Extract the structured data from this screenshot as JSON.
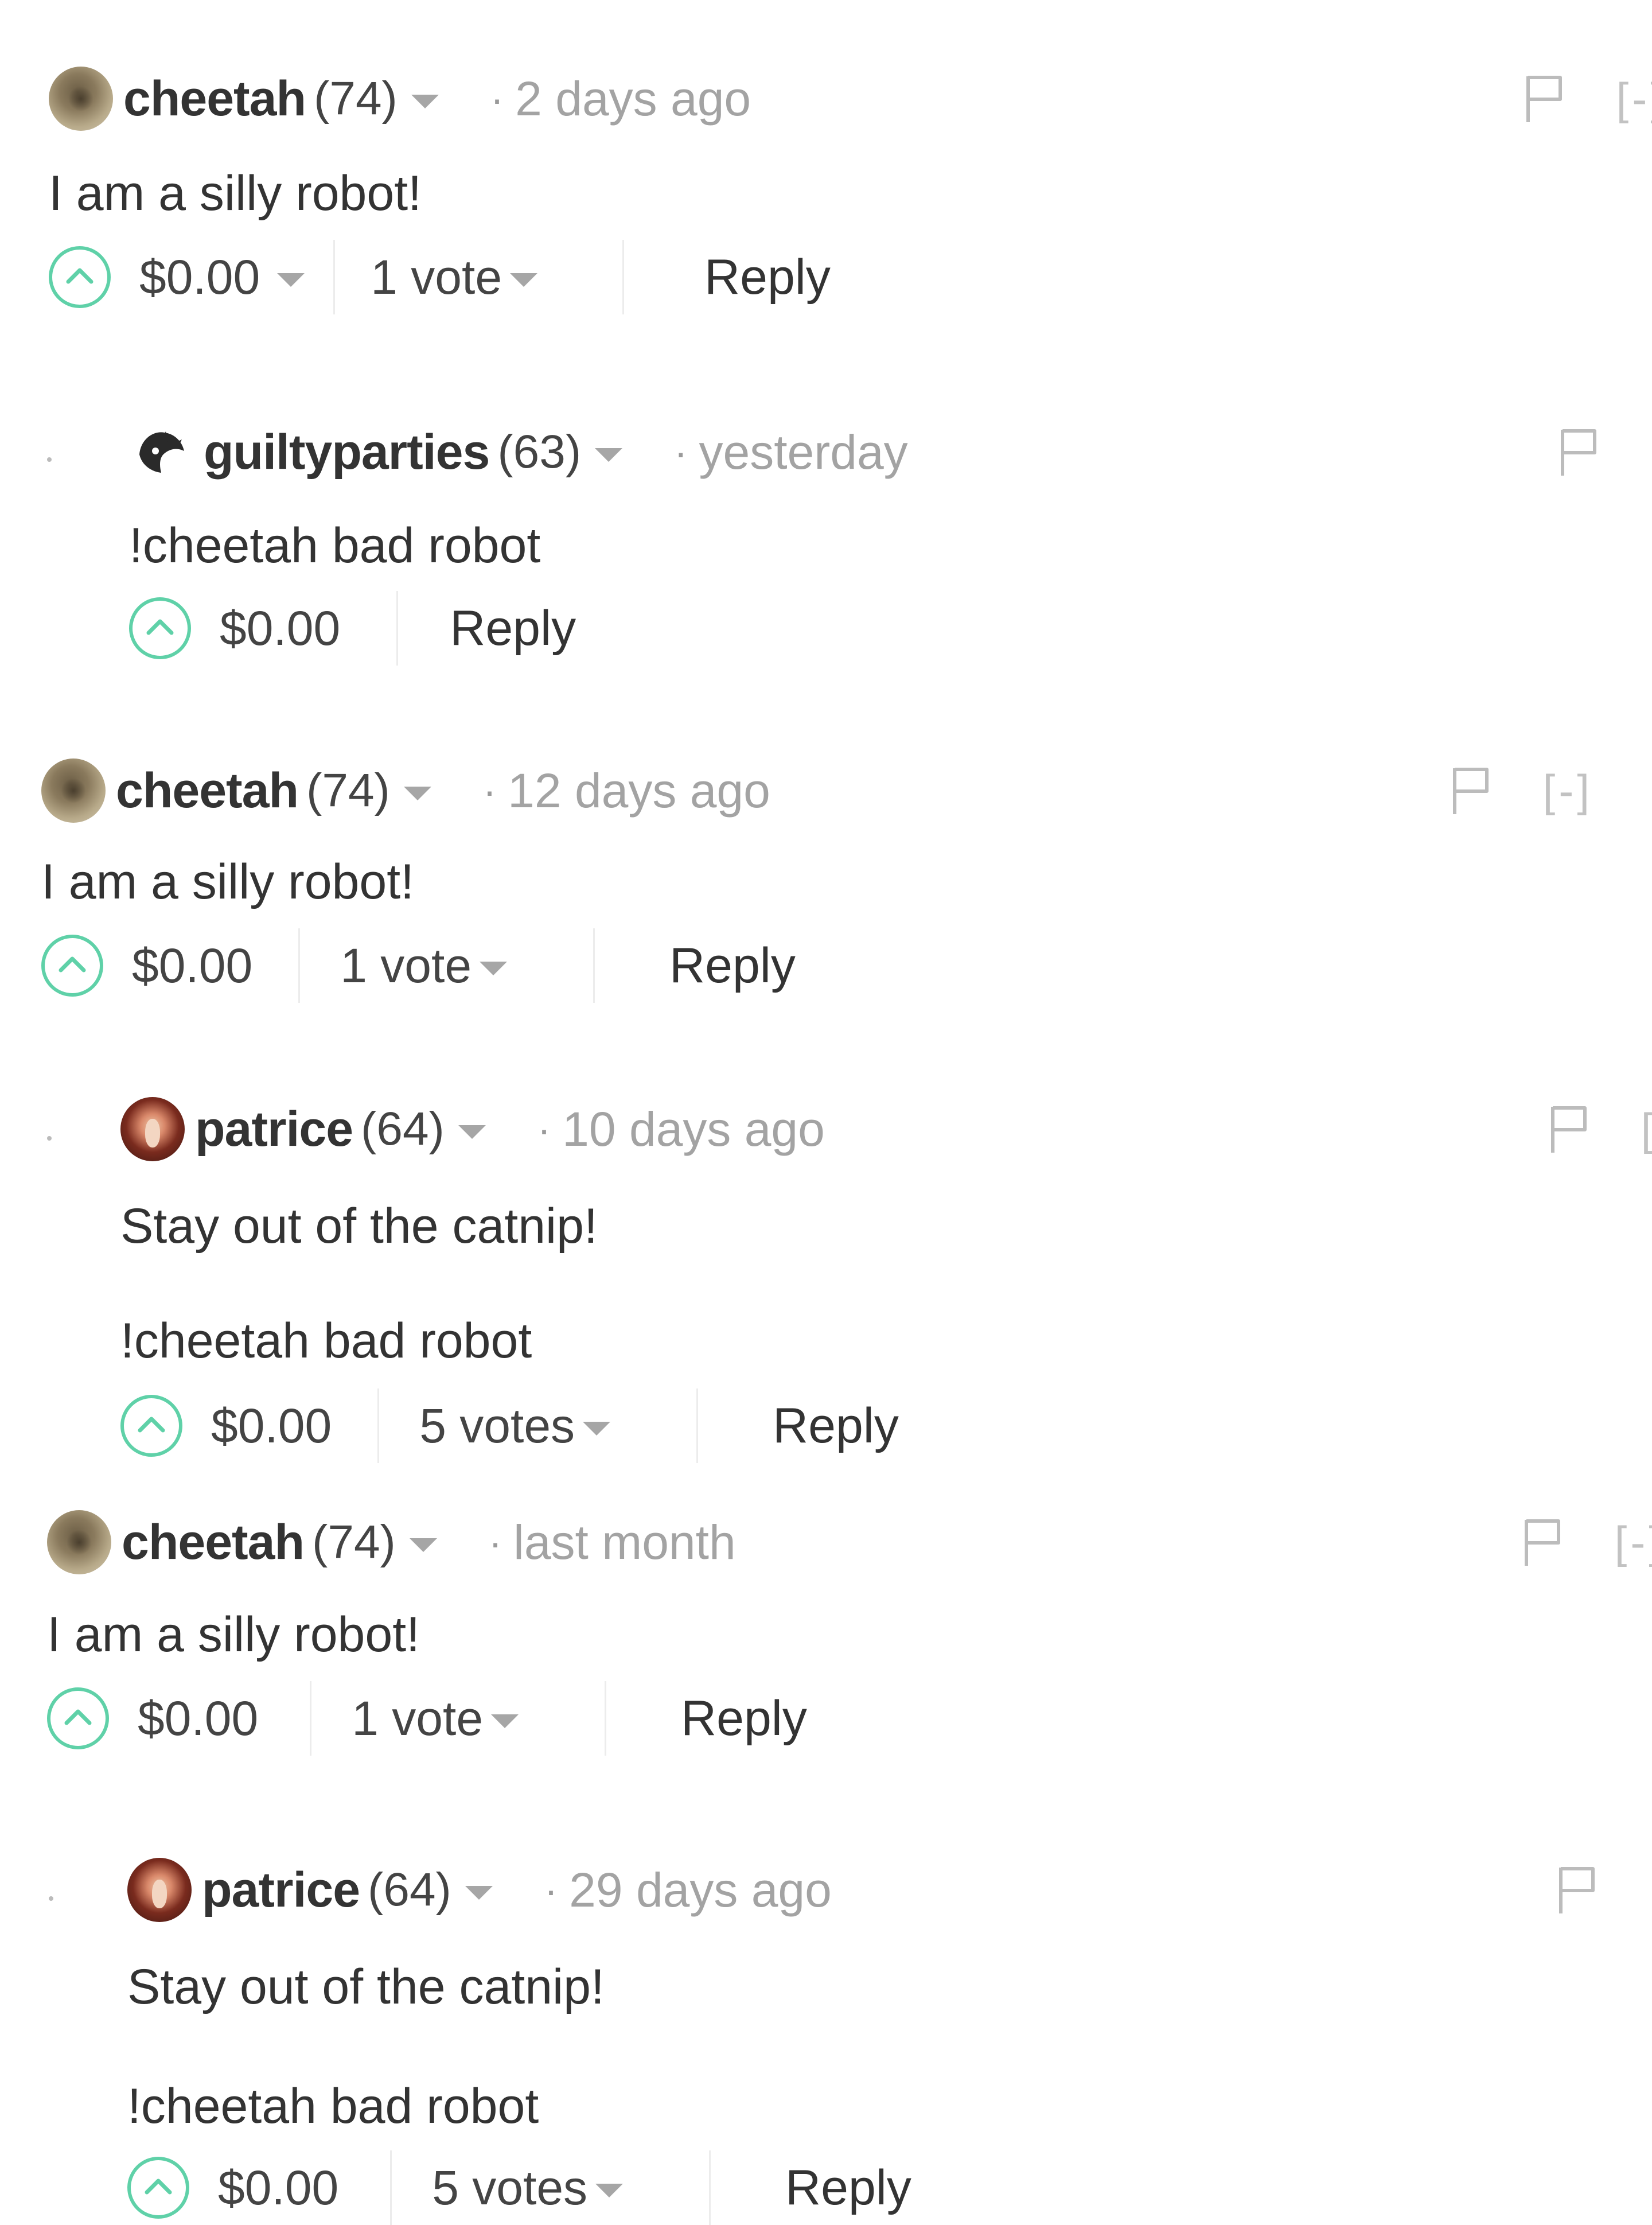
{
  "comments": [
    {
      "author": "cheetah",
      "reputation": "(74)",
      "time": "2 days ago",
      "body": [
        "I am a silly robot!"
      ],
      "payout": "$0.00",
      "votes": "1 vote",
      "reply_label": "Reply",
      "collapse_label": "[-]"
    },
    {
      "author": "guiltyparties",
      "reputation": "(63)",
      "time": "yesterday",
      "body": [
        "!cheetah bad robot"
      ],
      "payout": "$0.00",
      "votes": "",
      "reply_label": "Reply",
      "collapse_label": "[-]"
    },
    {
      "author": "cheetah",
      "reputation": "(74)",
      "time": "12 days ago",
      "body": [
        "I am a silly robot!"
      ],
      "payout": "$0.00",
      "votes": "1 vote",
      "reply_label": "Reply",
      "collapse_label": "[-]"
    },
    {
      "author": "patrice",
      "reputation": "(64)",
      "time": "10 days ago",
      "body": [
        "Stay out of the catnip!",
        "!cheetah bad robot"
      ],
      "payout": "$0.00",
      "votes": "5 votes",
      "reply_label": "Reply",
      "collapse_label": "[-]"
    },
    {
      "author": "cheetah",
      "reputation": "(74)",
      "time": "last month",
      "body": [
        "I am a silly robot!"
      ],
      "payout": "$0.00",
      "votes": "1 vote",
      "reply_label": "Reply",
      "collapse_label": "[-]"
    },
    {
      "author": "patrice",
      "reputation": "(64)",
      "time": "29 days ago",
      "body": [
        "Stay out of the catnip!",
        "!cheetah bad robot"
      ],
      "payout": "$0.00",
      "votes": "5 votes",
      "reply_label": "Reply",
      "collapse_label": "[-]"
    }
  ],
  "colors": {
    "upvote_accent": "#5fd1a8",
    "text_primary": "#333333",
    "text_muted": "#a3a3a3"
  },
  "icons": {
    "upvote": "chevron-up-circle-icon",
    "dropdown": "caret-down-icon",
    "flag": "flag-icon",
    "collapse": "collapse-toggle"
  }
}
